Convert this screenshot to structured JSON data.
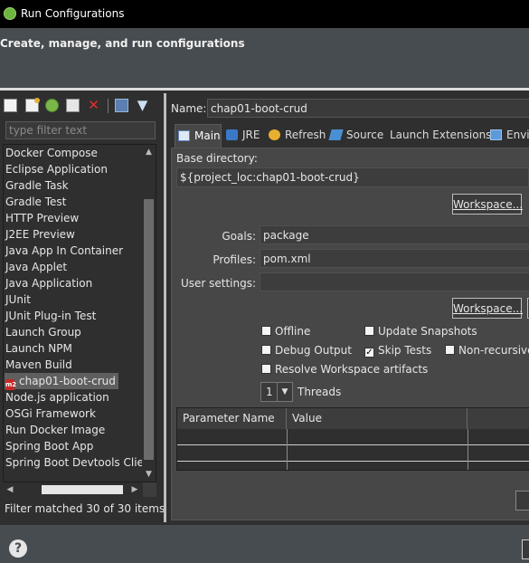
{
  "window": {
    "title": "Run Configurations",
    "icon": "spring-leaf-icon"
  },
  "header": {
    "heading": "Create, manage, and run configurations"
  },
  "left": {
    "toolbar": [
      "new-config-icon",
      "new-prototype-icon",
      "duplicate-icon",
      "export-icon",
      "delete-icon",
      "collapse-all-icon",
      "filter-icon"
    ],
    "filter_placeholder": "type filter text",
    "items": [
      "Docker Compose",
      "Eclipse Application",
      "Gradle Task",
      "Gradle Test",
      "HTTP Preview",
      "J2EE Preview",
      "Java App In Container",
      "Java Applet",
      "Java Application",
      "JUnit",
      "JUnit Plug-in Test",
      "Launch Group",
      "Launch NPM",
      "Maven Build",
      "chap01-boot-crud",
      "Node.js application",
      "OSGi Framework",
      "Run Docker Image",
      "Spring Boot App",
      "Spring Boot Devtools Client"
    ],
    "selected_item": "chap01-boot-crud",
    "maven_icon_text": "m2",
    "status": "Filter matched 30 of 30 items"
  },
  "right": {
    "name_label": "Name:",
    "name_value": "chap01-boot-crud",
    "tabs": {
      "main": "Main",
      "jre": "JRE",
      "refresh": "Refresh",
      "source": "Source",
      "launch_ext": "Launch Extensions",
      "env": "Envir"
    },
    "active_tab": "Main",
    "base_dir_label": "Base directory:",
    "base_dir_value": "${project_loc:chap01-boot-crud}",
    "workspace_btn": "Workspace...",
    "goals_label": "Goals:",
    "goals_value": "package",
    "profiles_label": "Profiles:",
    "profiles_value": "pom.xml",
    "user_settings_label": "User settings:",
    "user_settings_value": "",
    "checkboxes": {
      "offline": {
        "label": "Offline",
        "checked": false
      },
      "update_snapshots": {
        "label": "Update Snapshots",
        "checked": false
      },
      "debug_output": {
        "label": "Debug Output",
        "checked": false
      },
      "skip_tests": {
        "label": "Skip Tests",
        "checked": true
      },
      "non_recursive": {
        "label": "Non-recursive",
        "checked": false
      },
      "resolve_workspace": {
        "label": "Resolve Workspace artifacts",
        "checked": false
      }
    },
    "threads_value": "1",
    "threads_label": "Threads",
    "param_table": {
      "columns": [
        "Parameter Name",
        "Value"
      ]
    }
  },
  "help_icon": "help-icon"
}
